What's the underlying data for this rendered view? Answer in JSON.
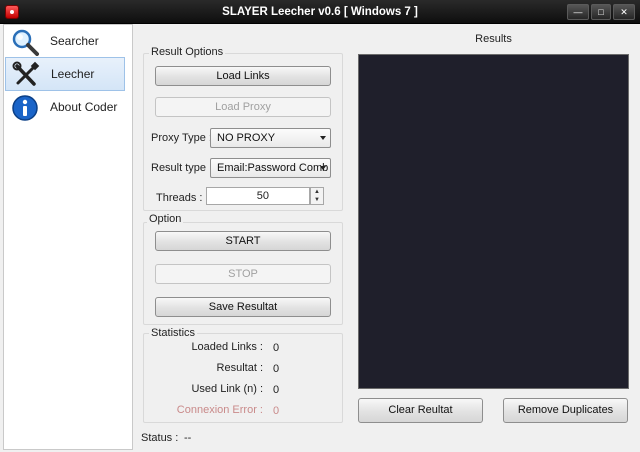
{
  "window": {
    "title": "SLAYER Leecher v0.6 [ Windows 7 ]",
    "min": "—",
    "max": "□",
    "close": "✕"
  },
  "sidebar": {
    "items": [
      {
        "label": "Searcher",
        "icon": "magnifier-icon"
      },
      {
        "label": "Leecher",
        "icon": "tools-icon"
      },
      {
        "label": "About Coder",
        "icon": "info-icon"
      }
    ]
  },
  "result_options": {
    "title": "Result Options",
    "load_links": "Load Links",
    "load_proxy": "Load Proxy",
    "proxy_type_label": "Proxy Type :",
    "proxy_type_value": "NO PROXY",
    "result_type_label": "Result type :",
    "result_type_value": "Email:Password Comb",
    "threads_label": "Threads :",
    "threads_value": "50"
  },
  "option": {
    "title": "Option",
    "start": "START",
    "stop": "STOP",
    "save": "Save Resultat"
  },
  "statistics": {
    "title": "Statistics",
    "loaded_links_label": "Loaded Links :",
    "loaded_links_value": "0",
    "resultat_label": "Resultat :",
    "resultat_value": "0",
    "used_link_label": "Used Link (n) :",
    "used_link_value": "0",
    "connexion_error_label": "Connexion Error :",
    "connexion_error_value": "0"
  },
  "status": {
    "label": "Status :",
    "value": "--"
  },
  "results": {
    "title": "Results",
    "clear": "Clear Reultat",
    "remove_duplicates": "Remove Duplicates"
  },
  "colors": {
    "results_bg": "#1f1f2b",
    "titlebar": "#111111",
    "error_text": "#c98a8a"
  }
}
